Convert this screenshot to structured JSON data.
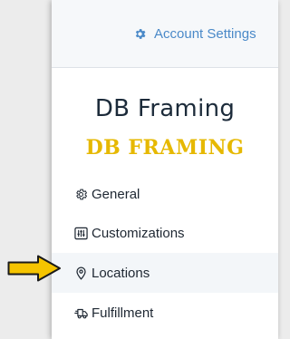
{
  "account": {
    "label": "Account Settings",
    "icon": "gear-icon",
    "color": "#4a89c8"
  },
  "brand": {
    "title": "DB Framing",
    "logo_text": "DB FRAMING",
    "logo_color": "#e6b800"
  },
  "nav": {
    "items": [
      {
        "label": "General",
        "icon": "gear-outline-icon"
      },
      {
        "label": "Customizations",
        "icon": "sliders-icon"
      },
      {
        "label": "Locations",
        "icon": "map-pin-icon"
      },
      {
        "label": "Fulfillment",
        "icon": "truck-icon"
      }
    ],
    "active": "Locations"
  },
  "annotation": {
    "icon": "arrow-right-icon",
    "color": "#f5c400"
  }
}
